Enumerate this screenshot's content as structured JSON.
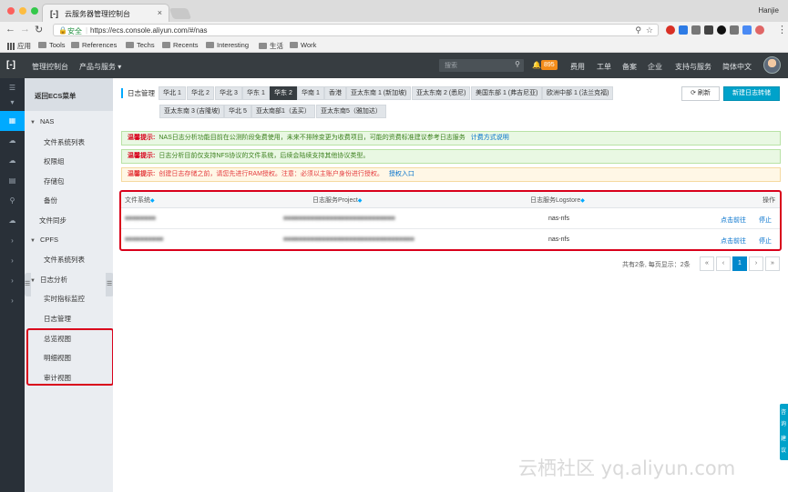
{
  "browser": {
    "tab_icon": "[-]",
    "tab_title": "云服务器管理控制台",
    "tab_close": "×",
    "user": "Hanjie",
    "secure_label": "安全",
    "url": "https://ecs.console.aliyun.com/#/nas",
    "bookmarks": [
      "应用",
      "Tools",
      "References",
      "Techs",
      "Recents",
      "Interesting",
      "生活",
      "Work"
    ]
  },
  "topnav": {
    "logo": "[-]",
    "console": "管理控制台",
    "products": "产品与服务 ▾",
    "search_placeholder": "搜索",
    "notification_count": "895",
    "links": [
      "费用",
      "工单",
      "备案",
      "企业",
      "支持与服务",
      "简体中文"
    ]
  },
  "sidebar": {
    "back": "返回ECS菜单",
    "items": [
      {
        "label": "NAS",
        "caret": "▼"
      },
      {
        "label": "文件系统列表"
      },
      {
        "label": "权限组"
      },
      {
        "label": "存储包"
      },
      {
        "label": "备份"
      },
      {
        "label": "文件同步"
      },
      {
        "label": "CPFS",
        "caret": "▼"
      },
      {
        "label": "文件系统列表"
      },
      {
        "label": "日志分析",
        "caret": "▼"
      },
      {
        "label": "实时指标监控"
      },
      {
        "label": "日志管理"
      },
      {
        "label": "总览视图"
      },
      {
        "label": "明细视图"
      },
      {
        "label": "审计视图"
      }
    ]
  },
  "main": {
    "title": "日志管理",
    "regions_row1": [
      "华北 1",
      "华北 2",
      "华北 3",
      "华东 1",
      "华东 2",
      "华南 1",
      "香港",
      "亚太东南 1 (新加坡)",
      "亚太东南 2 (悉尼)",
      "美国东部 1 (弗吉尼亚)",
      "欧洲中部 1 (法兰克福)"
    ],
    "regions_row2": [
      "亚太东南 3 (吉隆坡)",
      "华北 5",
      "亚太南部1（孟买）",
      "亚太东南5（雅加达）"
    ],
    "active_region": "华东 2",
    "refresh_label": "⟳ 刷新",
    "new_label": "新建日志转储",
    "alerts": [
      {
        "label": "温馨提示:",
        "text": "NAS日志分析功能目前在公测阶段免费使用，未来不排除变更为收费项目，可能的资费标准建议参考日志服务",
        "link": "计费方式说明"
      },
      {
        "label": "温馨提示:",
        "text": "日志分析目前仅支持NFS协议的文件系统，后续会陆续支持其他协议类型。",
        "link": ""
      },
      {
        "label": "温馨提示:",
        "text": "创建日志存储之前，请您先进行RAM授权。注意：必须以主账户身份进行授权。",
        "link": "授权入口"
      }
    ],
    "table": {
      "headers": [
        "文件系统",
        "日志服务Project",
        "日志服务Logstore",
        "操作"
      ],
      "rows": [
        {
          "fs": "■■■■■■■■",
          "project": "■■■■■■■■■■■■■■■■■■■■■■■■■■■■■",
          "logstore": "nas-nfs",
          "action1": "点击前往",
          "action2": "停止"
        },
        {
          "fs": "■■■■■■■■■■",
          "project": "■■■■■■■■■■■■■■■■■■■■■■■■■■■■■■■■■■",
          "logstore": "nas-nfs",
          "action1": "点击前往",
          "action2": "停止"
        }
      ]
    },
    "pager": {
      "info": "共有2条, 每页显示：2条",
      "first": "«",
      "prev": "‹",
      "page": "1",
      "next": "›",
      "last": "»"
    }
  },
  "watermark": "云栖社区 yq.aliyun.com",
  "side_float": [
    "咨",
    "询",
    "建",
    "议"
  ]
}
